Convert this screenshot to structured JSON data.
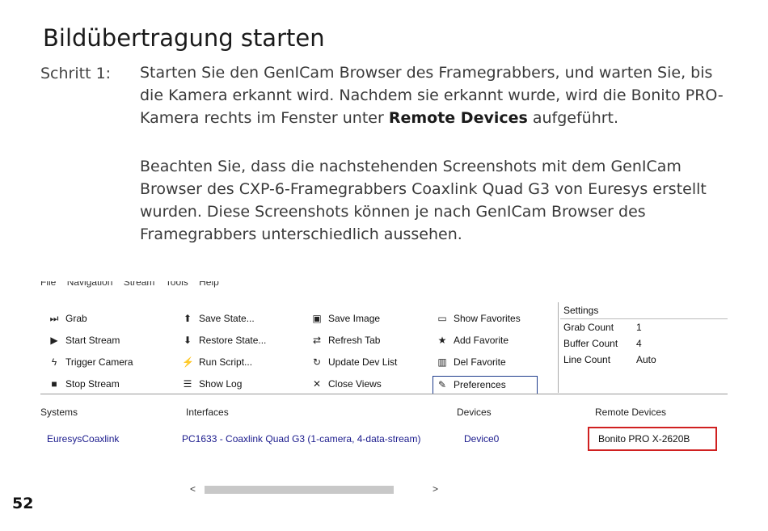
{
  "title": "Bildübertragung starten",
  "step_label": "Schritt 1:",
  "para1_text": "Starten Sie den GenICam Browser des Framegrabbers, und warten Sie, bis die Kamera erkannt wird. Nachdem sie erkannt wurde, wird die Bonito PRO-Kamera rechts im Fenster unter ",
  "para1_bold": "Remote Devices",
  "para1_end": " aufgeführt.",
  "para2": "Beachten Sie, dass die nachstehenden Screenshots mit dem GenICam Browser des CXP-6-Framegrabbers Coaxlink Quad G3 von Euresys erstellt wurden. Diese Screenshots können je nach GenICam Browser des Framegrabbers unterschiedlich aussehen.",
  "menu": [
    "File",
    "Navigation",
    "Stream",
    "Tools",
    "Help"
  ],
  "toolbar": {
    "col1": [
      {
        "icon": "grab-icon",
        "label": "Grab"
      },
      {
        "icon": "play-icon",
        "label": "Start Stream"
      },
      {
        "icon": "lightning-icon",
        "label": "Trigger Camera"
      },
      {
        "icon": "stop-icon",
        "label": "Stop Stream"
      }
    ],
    "col2": [
      {
        "icon": "save-state-icon",
        "label": "Save State..."
      },
      {
        "icon": "restore-state-icon",
        "label": "Restore State..."
      },
      {
        "icon": "run-script-icon",
        "label": "Run Script..."
      },
      {
        "icon": "show-log-icon",
        "label": "Show Log"
      }
    ],
    "col3": [
      {
        "icon": "save-image-icon",
        "label": "Save Image"
      },
      {
        "icon": "refresh-icon",
        "label": "Refresh Tab"
      },
      {
        "icon": "update-icon",
        "label": "Update Dev List"
      },
      {
        "icon": "close-icon",
        "label": "Close Views"
      }
    ],
    "col4": [
      {
        "icon": "show-favorites-icon",
        "label": "Show Favorites"
      },
      {
        "icon": "star-icon",
        "label": "Add Favorite"
      },
      {
        "icon": "trash-icon",
        "label": "Del Favorite"
      },
      {
        "icon": "wrench-icon",
        "label": "Preferences"
      }
    ]
  },
  "settings": {
    "header": "Settings",
    "rows": [
      {
        "key": "Grab Count",
        "value": "1"
      },
      {
        "key": "Buffer Count",
        "value": "4"
      },
      {
        "key": "Line Count",
        "value": "Auto"
      }
    ]
  },
  "tree": {
    "headers": {
      "systems": "Systems",
      "interfaces": "Interfaces",
      "devices": "Devices",
      "remote": "Remote Devices"
    },
    "values": {
      "systems": "EuresysCoaxlink",
      "interfaces": "PC1633 - Coaxlink Quad G3 (1-camera, 4-data-stream)",
      "devices": "Device0",
      "remote": "Bonito PRO X-2620B"
    }
  },
  "scroll": {
    "left": "<",
    "right": ">"
  },
  "page_number": "52",
  "colors": {
    "highlight_border": "#d02020",
    "link_text": "#1a1a8c"
  }
}
